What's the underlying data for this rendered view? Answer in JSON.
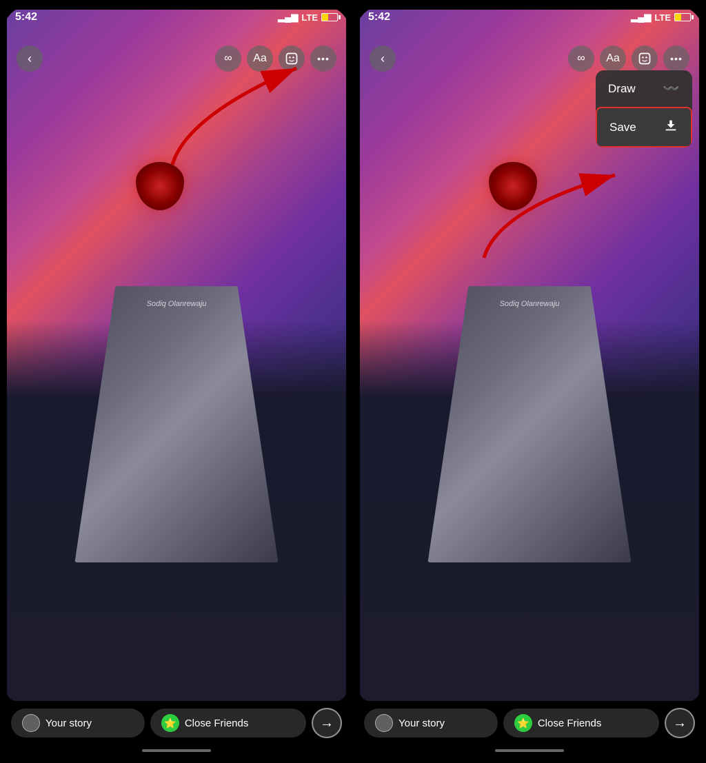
{
  "screens": [
    {
      "id": "left",
      "status": {
        "time": "5:42",
        "signal": "signal",
        "lte": "LTE",
        "battery": "battery"
      },
      "toolbar": {
        "back": "‹",
        "infinity": "∞",
        "text": "Aa",
        "sticker": "😊",
        "more": "•••"
      },
      "story": {
        "overlay_text": "Sodiq Olanrewaju"
      },
      "bottom": {
        "your_story": "Your story",
        "close_friends": "Close Friends",
        "send": "→"
      }
    },
    {
      "id": "right",
      "status": {
        "time": "5:42",
        "signal": "signal",
        "lte": "LTE",
        "battery": "battery"
      },
      "toolbar": {
        "back": "‹",
        "infinity": "∞",
        "text": "Aa",
        "sticker": "😊",
        "more": "•••"
      },
      "story": {
        "overlay_text": "Sodiq Olanrewaju"
      },
      "dropdown": {
        "draw_label": "Draw",
        "draw_icon": "〰",
        "save_label": "Save",
        "save_icon": "⬇"
      },
      "bottom": {
        "your_story": "Your story",
        "close_friends": "Close Friends",
        "send": "→"
      }
    }
  ]
}
